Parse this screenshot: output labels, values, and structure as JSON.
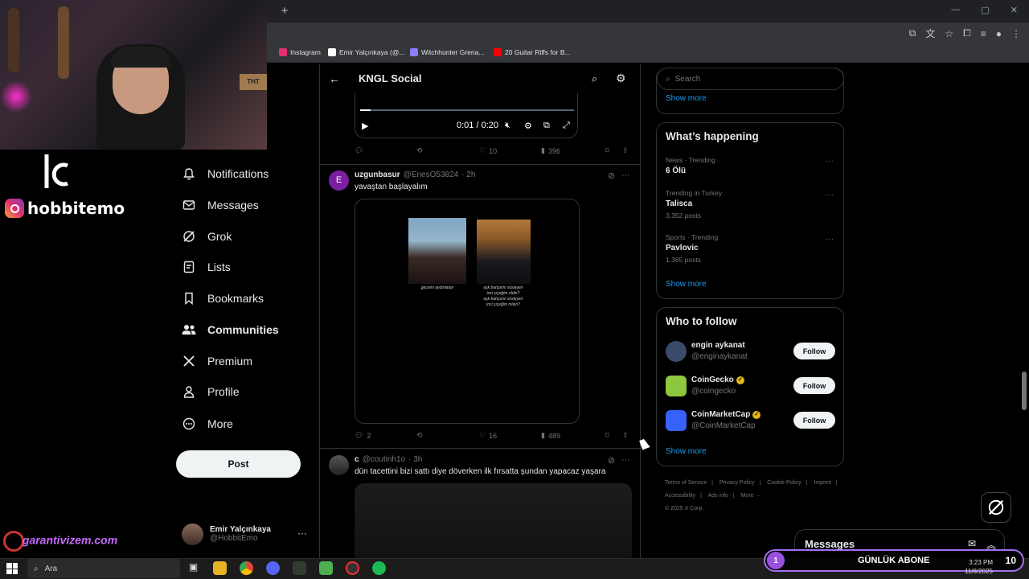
{
  "browser": {
    "new_tab": "+",
    "window_controls": [
      "—",
      "▢",
      "✕"
    ],
    "bookmarks": [
      {
        "label": "Instagram",
        "color": "#e1306c"
      },
      {
        "label": "Emir Yalçınkaya (@...",
        "color": "#ffffff"
      },
      {
        "label": "Witchhunter Grena...",
        "color": "#8a7cff"
      },
      {
        "label": "20 Guitar Riffs for B...",
        "color": "#ff0000"
      }
    ]
  },
  "overlay": {
    "instagram_handle": "hobbitemo",
    "brand_site": "garantivizem.com",
    "webcam_box_text": "ТНТ",
    "sub_counter": {
      "left": "1",
      "label": "GÜNLÜK ABONE",
      "right": "10"
    }
  },
  "nav": {
    "items": [
      {
        "label": "Notifications",
        "icon": "bell-icon"
      },
      {
        "label": "Messages",
        "icon": "envelope-icon"
      },
      {
        "label": "Grok",
        "icon": "grok-icon"
      },
      {
        "label": "Lists",
        "icon": "list-icon"
      },
      {
        "label": "Bookmarks",
        "icon": "bookmark-icon"
      },
      {
        "label": "Communities",
        "icon": "communities-icon"
      },
      {
        "label": "Premium",
        "icon": "x-logo-icon"
      },
      {
        "label": "Profile",
        "icon": "person-icon"
      },
      {
        "label": "More",
        "icon": "more-circle-icon"
      }
    ],
    "post_label": "Post",
    "account": {
      "name": "Emir Yalçınkaya",
      "handle": "@HobbitEmo",
      "more": "···"
    }
  },
  "center": {
    "title": "KNGL Social",
    "video": {
      "time": "0:01 / 0:20",
      "progress": 0.05
    },
    "tweet0_actions": {
      "replies": "",
      "reposts": "",
      "likes": "10",
      "views": "396"
    },
    "tweet1": {
      "avatar_letter": "E",
      "avatar_color": "#7b1fa2",
      "name": "uzgunbasur",
      "handle": "@EnesO53824",
      "time": "· 2h",
      "text": "yavaştan başlayalım",
      "caption1": "gecemi aydınlatan",
      "caption2_lines": [
        "aşk bahçemi süsleyen",
        "inci çiçeğim oldin?",
        "aşk bahçemi süsleyen",
        "inci çiçeğim misin?"
      ],
      "actions": {
        "replies": "2",
        "reposts": "",
        "likes": "16",
        "views": "489"
      }
    },
    "tweet2": {
      "name": "c",
      "handle": "@coutinh1o",
      "time": "· 3h",
      "text": "dün tacettini bizi sattı diye döverken ilk fırsatta şundan yapacaz yaşara"
    }
  },
  "right": {
    "search_placeholder": "Search",
    "show_more_top": "Show more",
    "happening_title": "What’s happening",
    "trends": [
      {
        "meta": "News · Trending",
        "name": "6 Ölü",
        "posts": ""
      },
      {
        "meta": "Trending in Turkey",
        "name": "Talisca",
        "posts": "3,352 posts"
      },
      {
        "meta": "Sports · Trending",
        "name": "Pavlovic",
        "posts": "1,365 posts"
      }
    ],
    "show_more_trends": "Show more",
    "wtf_title": "Who to follow",
    "follow_label": "Follow",
    "follows": [
      {
        "name": "engin aykanat",
        "handle": "@enginaykanat",
        "verified": false,
        "avatar_color": "#3a4a6a"
      },
      {
        "name": "CoinGecko",
        "handle": "@coingecko",
        "verified": true,
        "avatar_color": "#8dc63f"
      },
      {
        "name": "CoinMarketCap",
        "handle": "@CoinMarketCap",
        "verified": true,
        "avatar_color": "#3861fb"
      }
    ],
    "show_more_follow": "Show more",
    "footer": [
      "Terms of Service",
      "|",
      "Privacy Policy",
      "|",
      "Cookie Policy",
      "|",
      "Imprint",
      "|",
      "Accessibility",
      "|",
      "Ads info",
      "|",
      "More ···",
      "© 2025 X Corp."
    ],
    "messages_label": "Messages"
  },
  "taskbar": {
    "search_placeholder": "Ara",
    "time": "3:23 PM",
    "date": "11/8/2025"
  }
}
